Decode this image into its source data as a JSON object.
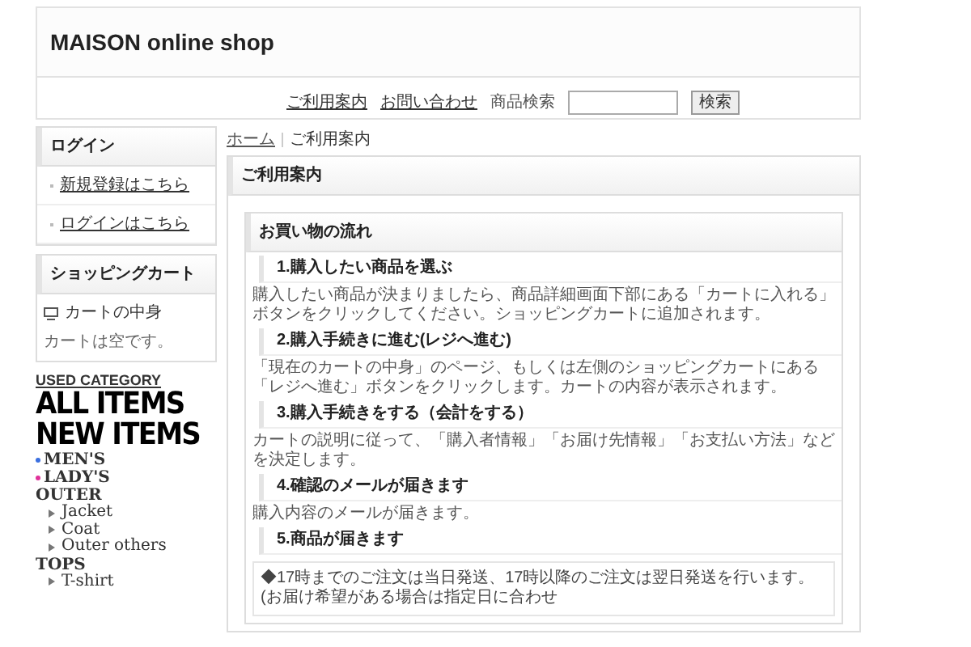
{
  "header": {
    "title": "MAISON online shop"
  },
  "nav": {
    "links": [
      "ご利用案内",
      "お問い合わせ"
    ],
    "search_label": "商品検索",
    "search_button": "検索"
  },
  "sidebar": {
    "login": {
      "title": "ログイン",
      "links": [
        "新規登録はこちら",
        "ログインはこちら"
      ]
    },
    "cart": {
      "title": "ショッピングカート",
      "link": "カートの中身",
      "status": "カートは空です。"
    },
    "category": [
      {
        "kind": "title",
        "label": "USED CATEGORY"
      },
      {
        "kind": "feature",
        "label": "ALL ITEMS"
      },
      {
        "kind": "feature",
        "label": "NEW ITEMS"
      },
      {
        "kind": "gender",
        "label": "MEN'S",
        "color": "#3b6fe0"
      },
      {
        "kind": "gender",
        "label": "LADY'S",
        "color": "#e0329a"
      },
      {
        "kind": "group",
        "label": "OUTER",
        "children": [
          {
            "label": "Jacket"
          },
          {
            "label": "Coat"
          },
          {
            "label": "Outer others"
          }
        ]
      },
      {
        "kind": "group",
        "label": "TOPS",
        "children": [
          {
            "label": "T-shirt"
          }
        ]
      }
    ]
  },
  "breadcrumb": [
    "ホーム",
    "ご利用案内"
  ],
  "page": {
    "title": "ご利用案内",
    "section_title": "お買い物の流れ",
    "steps": [
      {
        "title": "1.購入したい商品を選ぶ",
        "text": "購入したい商品が決まりましたら、商品詳細画面下部にある「カートに入れる」ボタンをクリックしてください。ショッピングカートに追加されます。"
      },
      {
        "title": "2.購入手続きに進む(レジへ進む)",
        "text": "「現在のカートの中身」のページ、もしくは左側のショッピングカートにある「レジへ進む」ボタンをクリックします。カートの内容が表示されます。"
      },
      {
        "title": "3.購入手続きをする（会計をする）",
        "text": "カートの説明に従って、「購入者情報」「お届け先情報」「お支払い方法」などを決定します。"
      },
      {
        "title": "4.確認のメールが届きます",
        "text": "購入内容のメールが届きます。"
      },
      {
        "title": "5.商品が届きます"
      }
    ],
    "notice": "◆17時までのご注文は当日発送、17時以降のご注文は翌日発送を行います。(お届け希望がある場合は指定日に合わせ"
  }
}
